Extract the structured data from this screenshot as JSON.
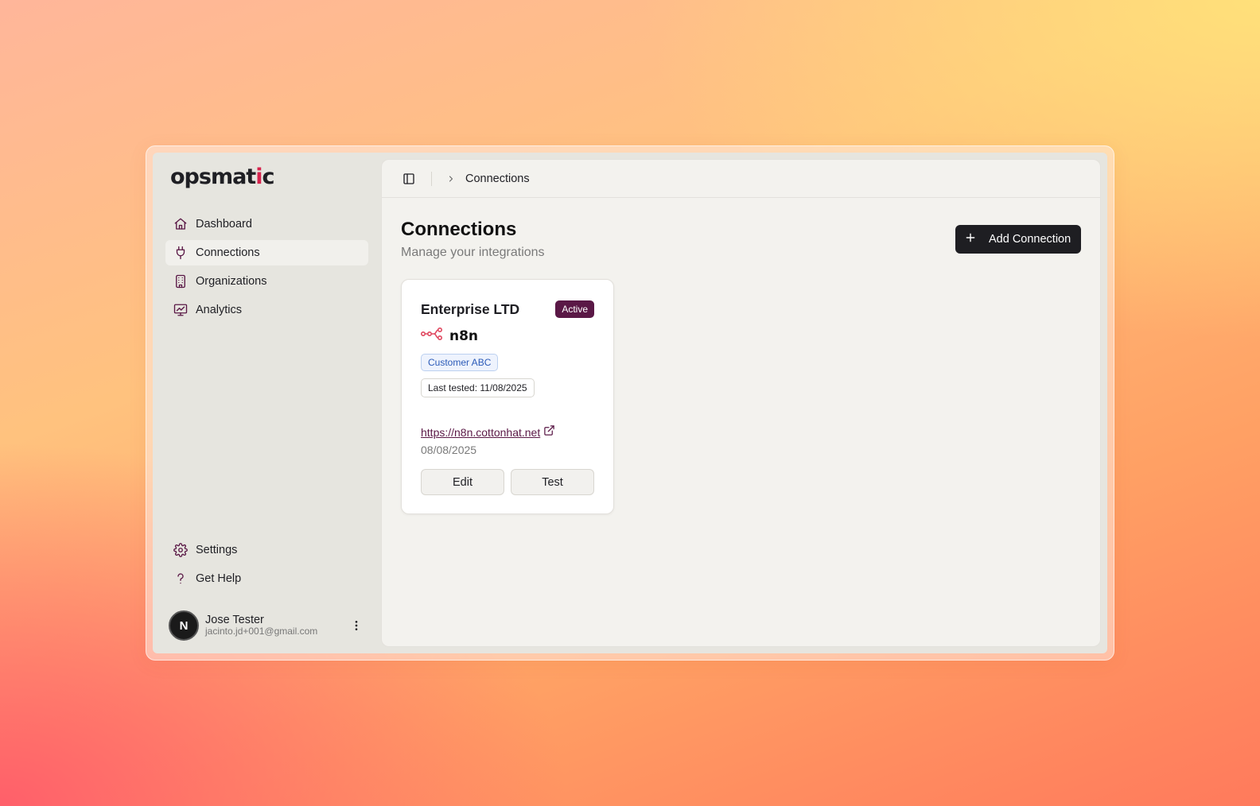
{
  "app": {
    "logo_text": "opsmat",
    "logo_accent": "i",
    "logo_tail": "c"
  },
  "sidebar": {
    "items": [
      {
        "label": "Dashboard",
        "icon": "home-icon"
      },
      {
        "label": "Connections",
        "icon": "plug-icon",
        "active": true
      },
      {
        "label": "Organizations",
        "icon": "building-icon"
      },
      {
        "label": "Analytics",
        "icon": "presentation-chart-icon"
      }
    ],
    "bottom_items": [
      {
        "label": "Settings",
        "icon": "gear-icon"
      },
      {
        "label": "Get Help",
        "icon": "question-icon"
      }
    ],
    "user": {
      "avatar_initial": "N",
      "name": "Jose Tester",
      "email": "jacinto.jd+001@gmail.com"
    }
  },
  "header": {
    "breadcrumb": "Connections"
  },
  "main": {
    "title": "Connections",
    "subtitle": "Manage your integrations",
    "add_button_label": "Add Connection"
  },
  "connections": [
    {
      "name": "Enterprise LTD",
      "status": "Active",
      "provider": "n8n",
      "customer": "Customer ABC",
      "last_tested": "Last tested: 11/08/2025",
      "url": "https://n8n.cottonhat.net",
      "date": "08/08/2025",
      "edit_label": "Edit",
      "test_label": "Test"
    }
  ],
  "colors": {
    "brand": "#5a1846",
    "logo_accent": "#d6234d",
    "icon_stroke": "#5a1846",
    "n8n": "#e0475f"
  }
}
